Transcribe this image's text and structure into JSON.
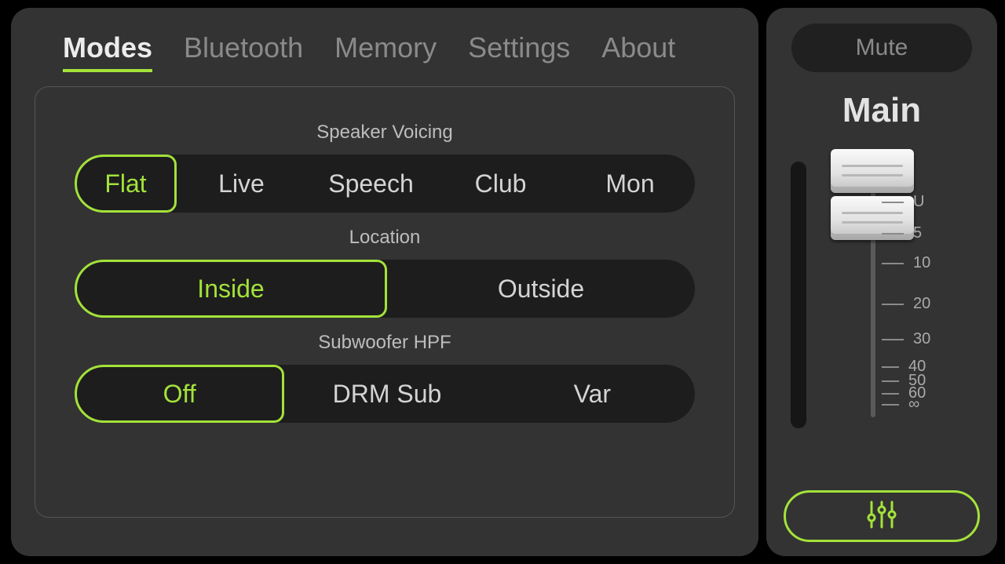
{
  "tabs": [
    {
      "label": "Modes",
      "active": true
    },
    {
      "label": "Bluetooth",
      "active": false
    },
    {
      "label": "Memory",
      "active": false
    },
    {
      "label": "Settings",
      "active": false
    },
    {
      "label": "About",
      "active": false
    }
  ],
  "sections": {
    "voicing": {
      "title": "Speaker Voicing",
      "options": [
        "Flat",
        "Live",
        "Speech",
        "Club",
        "Mon"
      ],
      "selected": "Flat"
    },
    "location": {
      "title": "Location",
      "options": [
        "Inside",
        "Outside"
      ],
      "selected": "Inside"
    },
    "hpf": {
      "title": "Subwoofer HPF",
      "options": [
        "Off",
        "DRM Sub",
        "Var"
      ],
      "selected": "Off"
    }
  },
  "side": {
    "mute_label": "Mute",
    "main_label": "Main",
    "scale": [
      "U",
      "5",
      "10",
      "20",
      "30",
      "40",
      "50",
      "60",
      "∞"
    ]
  },
  "colors": {
    "accent": "#a3e23a"
  }
}
